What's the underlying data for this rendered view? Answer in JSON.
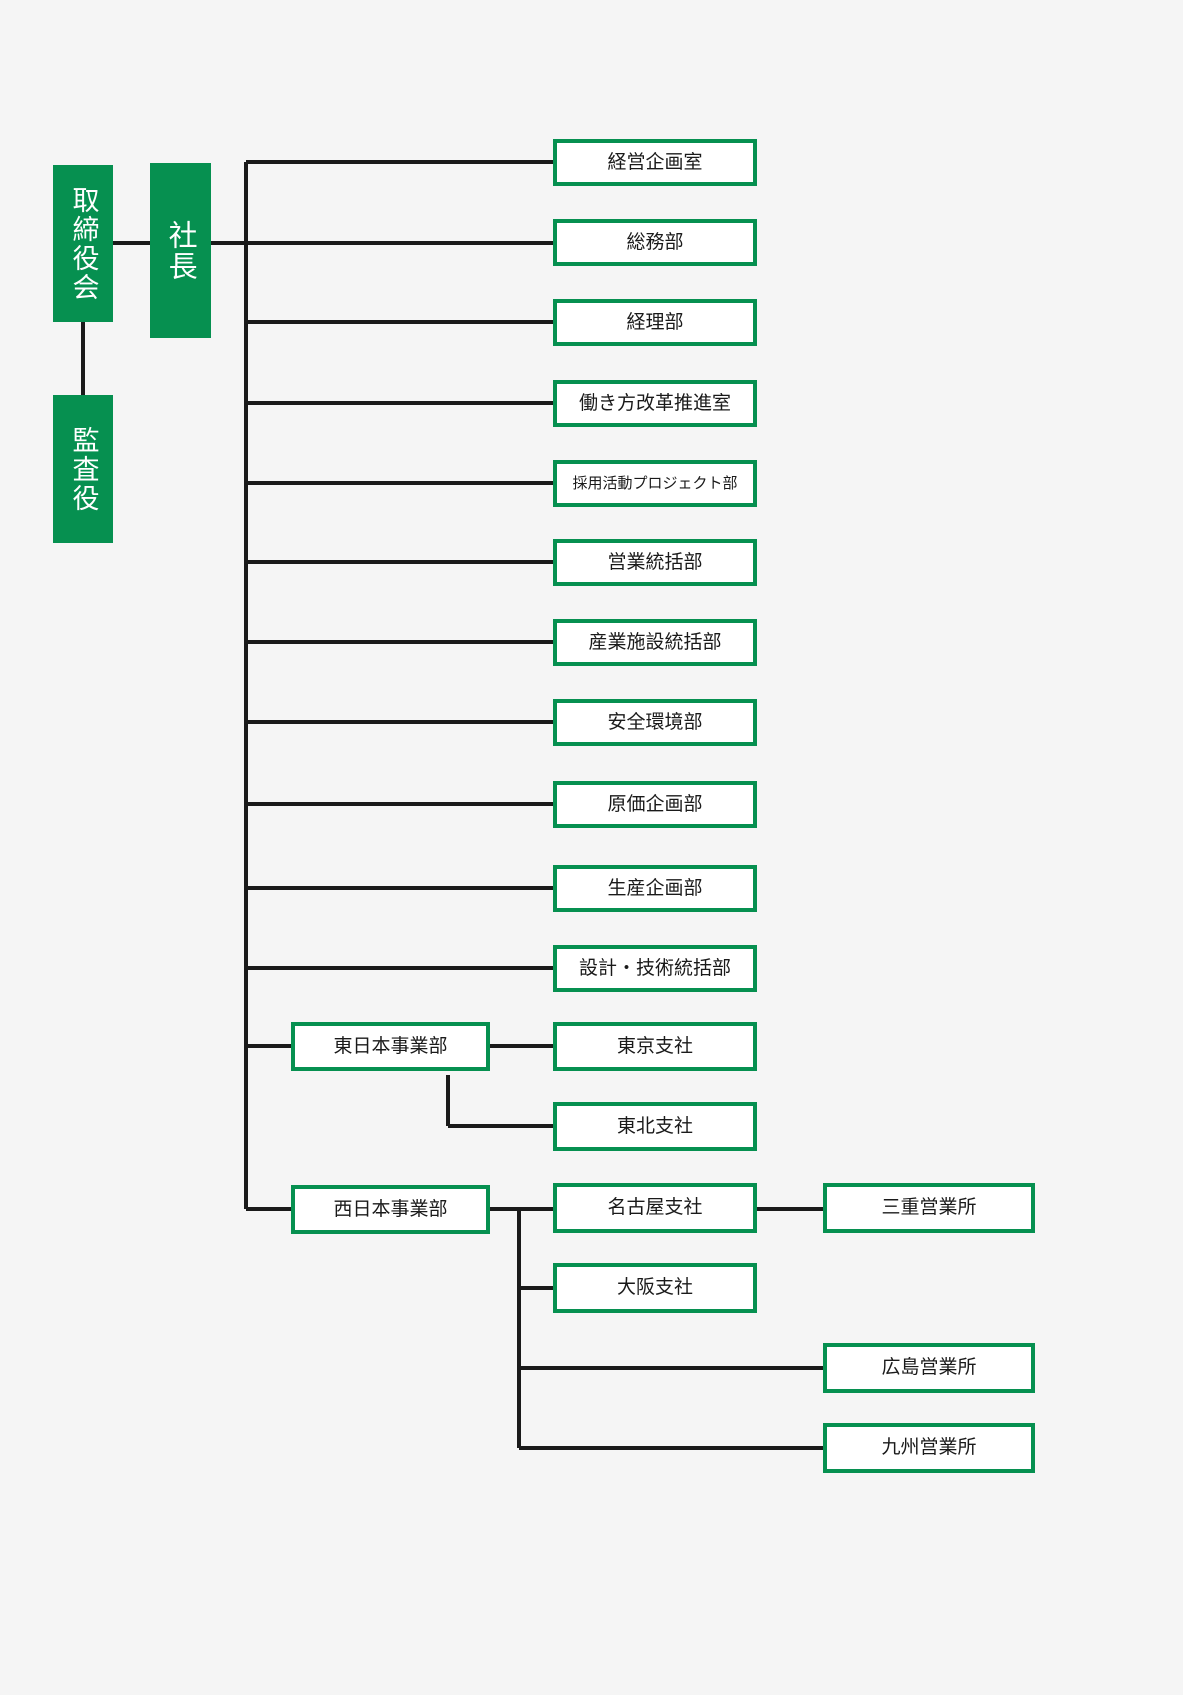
{
  "diagram": {
    "type": "organization-chart",
    "title": "",
    "colors": {
      "accent_green": "#069050",
      "box_fill": "#ffffff",
      "background": "#f5f5f5",
      "connector": "#1a1a1a",
      "filled_text": "#ffffff",
      "outlined_text": "#1a1a1a"
    },
    "nodes": {
      "board": {
        "label": "取締役会",
        "style": "filled",
        "orientation": "vertical"
      },
      "auditor": {
        "label": "監査役",
        "style": "filled",
        "orientation": "vertical"
      },
      "president": {
        "label": "社長",
        "style": "filled",
        "orientation": "vertical"
      },
      "d01": {
        "label": "経営企画室",
        "style": "outlined"
      },
      "d02": {
        "label": "総務部",
        "style": "outlined"
      },
      "d03": {
        "label": "経理部",
        "style": "outlined"
      },
      "d04": {
        "label": "働き方改革推進室",
        "style": "outlined"
      },
      "d05": {
        "label": "採用活動プロジェクト部",
        "style": "outlined"
      },
      "d06": {
        "label": "営業統括部",
        "style": "outlined"
      },
      "d07": {
        "label": "産業施設統括部",
        "style": "outlined"
      },
      "d08": {
        "label": "安全環境部",
        "style": "outlined"
      },
      "d09": {
        "label": "原価企画部",
        "style": "outlined"
      },
      "d10": {
        "label": "生産企画部",
        "style": "outlined"
      },
      "d11": {
        "label": "設計・技術統括部",
        "style": "outlined"
      },
      "east_div": {
        "label": "東日本事業部",
        "style": "outlined"
      },
      "tokyo": {
        "label": "東京支社",
        "style": "outlined"
      },
      "tohoku": {
        "label": "東北支社",
        "style": "outlined"
      },
      "west_div": {
        "label": "西日本事業部",
        "style": "outlined"
      },
      "nagoya": {
        "label": "名古屋支社",
        "style": "outlined"
      },
      "mie": {
        "label": "三重営業所",
        "style": "outlined"
      },
      "osaka": {
        "label": "大阪支社",
        "style": "outlined"
      },
      "hiroshima": {
        "label": "広島営業所",
        "style": "outlined"
      },
      "kyushu": {
        "label": "九州営業所",
        "style": "outlined"
      }
    },
    "hierarchy": [
      {
        "parent": "board",
        "child": "auditor"
      },
      {
        "parent": "board",
        "child": "president"
      },
      {
        "parent": "president",
        "child": "d01"
      },
      {
        "parent": "president",
        "child": "d02"
      },
      {
        "parent": "president",
        "child": "d03"
      },
      {
        "parent": "president",
        "child": "d04"
      },
      {
        "parent": "president",
        "child": "d05"
      },
      {
        "parent": "president",
        "child": "d06"
      },
      {
        "parent": "president",
        "child": "d07"
      },
      {
        "parent": "president",
        "child": "d08"
      },
      {
        "parent": "president",
        "child": "d09"
      },
      {
        "parent": "president",
        "child": "d10"
      },
      {
        "parent": "president",
        "child": "d11"
      },
      {
        "parent": "president",
        "child": "east_div"
      },
      {
        "parent": "president",
        "child": "west_div"
      },
      {
        "parent": "east_div",
        "child": "tokyo"
      },
      {
        "parent": "east_div",
        "child": "tohoku"
      },
      {
        "parent": "west_div",
        "child": "nagoya"
      },
      {
        "parent": "west_div",
        "child": "osaka"
      },
      {
        "parent": "west_div",
        "child": "hiroshima"
      },
      {
        "parent": "west_div",
        "child": "kyushu"
      },
      {
        "parent": "nagoya",
        "child": "mie"
      }
    ]
  }
}
